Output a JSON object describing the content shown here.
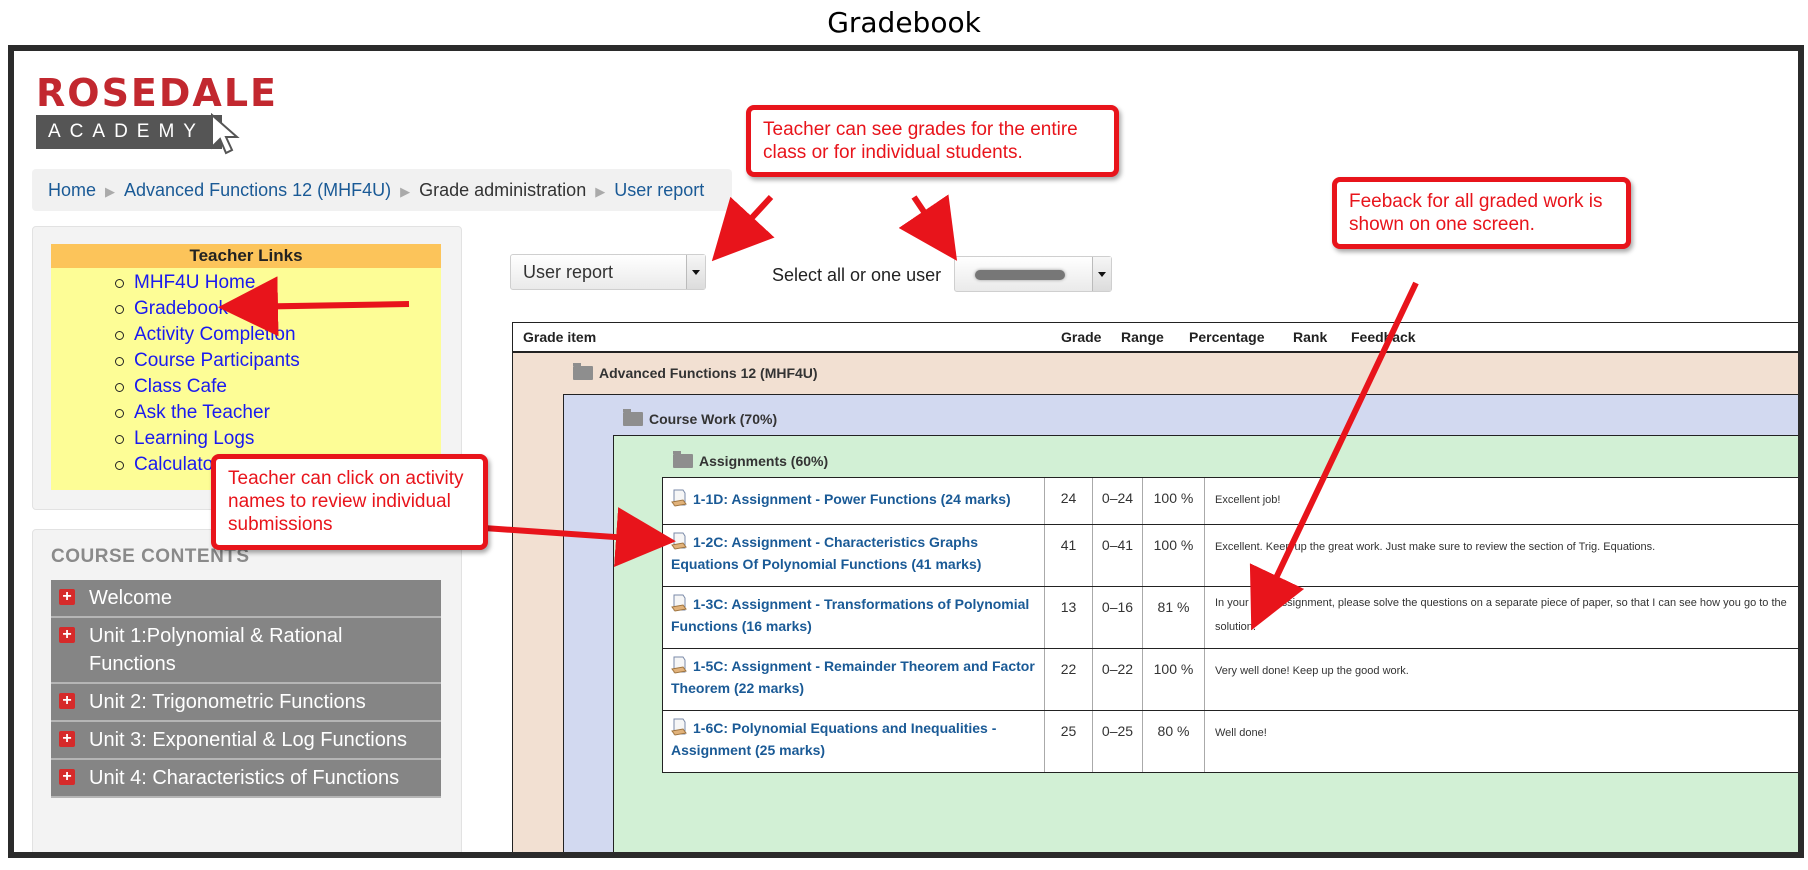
{
  "page_title": "Gradebook",
  "logo": {
    "name_top": "ROSEDALE",
    "name_bottom": "ACADEMY"
  },
  "breadcrumb": [
    "Home",
    "Advanced Functions 12 (MHF4U)",
    "Grade administration",
    "User report"
  ],
  "teacher_links": {
    "title": "Teacher Links",
    "items": [
      "MHF4U Home",
      "Gradebook",
      "Activity Completion",
      "Course Participants",
      "Class Cafe",
      "Ask the Teacher",
      "Learning Logs",
      "Calculator"
    ]
  },
  "course_contents": {
    "title": "COURSE CONTENTS",
    "items": [
      "Welcome",
      "Unit 1:Polynomial & Rational Functions",
      "Unit 2: Trigonometric Functions",
      "Unit 3: Exponential & Log Functions",
      "Unit 4: Characteristics of Functions"
    ]
  },
  "report_select": {
    "value": "User report"
  },
  "user_select": {
    "label": "Select all or one user"
  },
  "grade_table": {
    "columns": [
      "Grade item",
      "Grade",
      "Range",
      "Percentage",
      "Rank",
      "Feedback"
    ],
    "course": "Advanced Functions 12 (MHF4U)",
    "category": "Course Work (70%)",
    "subcategory": "Assignments (60%)",
    "rows": [
      {
        "item": "1-1D: Assignment - Power Functions (24 marks)",
        "grade": "24",
        "range": "0–24",
        "percentage": "100 %",
        "feedback": "Excellent job!"
      },
      {
        "item": "1-2C: Assignment - Characteristics Graphs Equations Of Polynomial Functions (41 marks)",
        "grade": "41",
        "range": "0–41",
        "percentage": "100 %",
        "feedback": "Excellent. Keep up the great work. Just make sure to review the section of Trig. Equations."
      },
      {
        "item": "1-3C: Assignment - Transformations of Polynomial Functions (16 marks)",
        "grade": "13",
        "range": "0–16",
        "percentage": "81 %",
        "feedback": "In your next assignment, please solve the questions on a separate piece of paper, so that I can see how you go to the solution."
      },
      {
        "item": "1-5C: Assignment - Remainder Theorem and Factor Theorem (22 marks)",
        "grade": "22",
        "range": "0–22",
        "percentage": "100 %",
        "feedback": "Very well done! Keep up the good work."
      },
      {
        "item": "1-6C: Polynomial Equations and Inequalities - Assignment (25 marks)",
        "grade": "25",
        "range": "0–25",
        "percentage": "80 %",
        "feedback": "Well done!"
      }
    ]
  },
  "callouts": {
    "grades": "Teacher can see grades for the entire class or for individual students.",
    "feedback": "Feeback for all graded work is shown on one screen.",
    "activity": "Teacher can click on activity names to review individual submissions"
  },
  "colors": {
    "callout_red": "#e8141b",
    "link_blue": "#1a5a96",
    "brand_red": "#c2282f"
  }
}
